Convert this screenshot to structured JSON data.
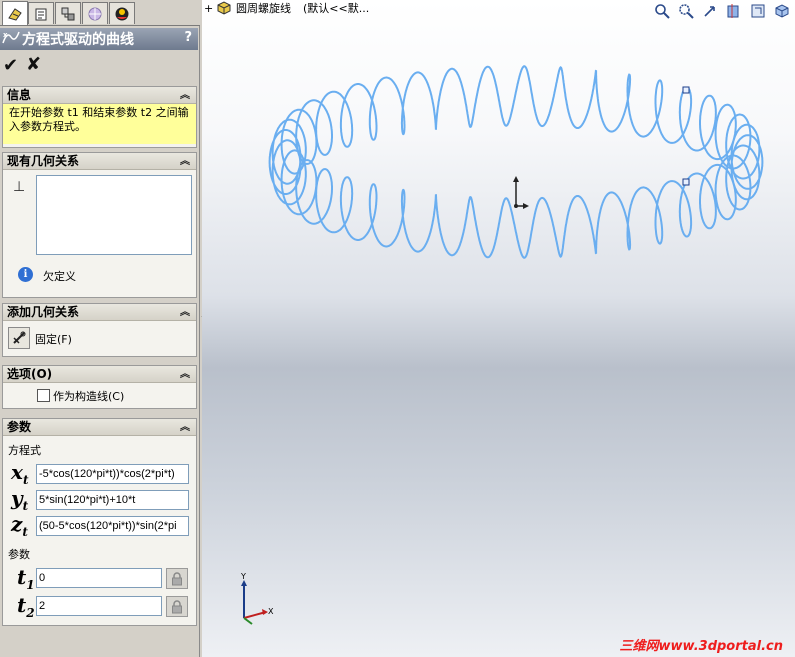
{
  "tabs": [
    {
      "icon": "feature-manager-icon",
      "active": true
    },
    {
      "icon": "property-manager-icon",
      "active": false
    },
    {
      "icon": "configuration-manager-icon",
      "active": false
    },
    {
      "icon": "dimxpert-icon",
      "active": false
    },
    {
      "icon": "display-manager-icon",
      "active": false
    }
  ],
  "property_manager": {
    "title": "方程式驱动的曲线",
    "help": "?",
    "ok_icon": "✔",
    "cancel_icon": "✘"
  },
  "info": {
    "title": "信息",
    "text": "在开始参数 t1 和结束参数 t2 之间输入参数方程式。"
  },
  "existing_relations": {
    "title": "现有几何关系",
    "status": "欠定义"
  },
  "add_relations": {
    "title": "添加几何关系",
    "fix_label": "固定(F)"
  },
  "options": {
    "title": "选项(O)",
    "construction_label": "作为构造线(C)"
  },
  "parameters": {
    "title": "参数",
    "equations_label": "方程式",
    "x_var": "x",
    "y_var": "y",
    "z_var": "z",
    "subscript": "t",
    "x_eq": "-5*cos(120*pi*t))*cos(2*pi*t)",
    "y_eq": "5*sin(120*pi*t)+10*t",
    "z_eq": "(50-5*cos(120*pi*t))*sin(2*pi",
    "params_label": "参数",
    "t_var": "t",
    "t1_sub": "1",
    "t2_sub": "2",
    "t1_value": "0",
    "t2_value": "2"
  },
  "viewport": {
    "tree_expand": "+",
    "part_name": "圆周螺旋线",
    "configuration": "(默认<<默...",
    "triad_y": "Y",
    "triad_x": "X",
    "watermark": "三维网www.3dportal.cn"
  },
  "colors": {
    "helix": "#6aaef0",
    "title_bar": "#7a8598",
    "info_background": "#ffff9a",
    "watermark": "#ee1d1d"
  }
}
